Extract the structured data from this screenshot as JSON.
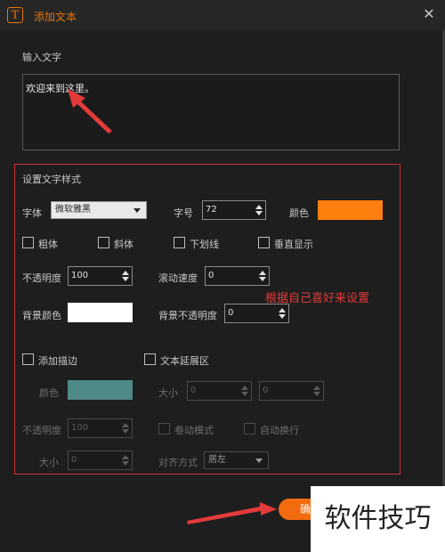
{
  "dialog": {
    "icon_glyph": "T",
    "title": "添加文本",
    "close_glyph": "✕"
  },
  "input_section": {
    "label": "输入文字",
    "value": "欢迎来到这里。"
  },
  "style_section": {
    "title": "设置文字样式",
    "font_label": "字体",
    "font_value": "微软雅黑",
    "size_label": "字号",
    "size_value": "72",
    "color_label": "颜色",
    "text_color": "#ff7f0e",
    "bold_label": "粗体",
    "italic_label": "斜体",
    "underline_label": "下划线",
    "vertical_label": "垂直显示",
    "opacity_label": "不透明度",
    "opacity_value": "100",
    "scroll_speed_label": "滚动速度",
    "scroll_speed_value": "0",
    "bg_color_label": "背景颜色",
    "bg_color": "#ffffff",
    "bg_opacity_label": "背景不透明度",
    "bg_opacity_value": "0"
  },
  "annotation": "根据自己喜好来设置",
  "stroke_section": {
    "add_stroke_label": "添加描边",
    "color_label": "颜色",
    "stroke_color": "#4f8a87",
    "opacity_label": "不透明度",
    "opacity_value": "100",
    "size_label": "大小",
    "size_value": "0"
  },
  "expand_section": {
    "expand_label": "文本延展区",
    "size_label": "大小",
    "width_value": "0",
    "height_value": "0",
    "scroll_mode_label": "卷动模式",
    "auto_wrap_label": "自动换行",
    "align_label": "对齐方式",
    "align_value": "居左"
  },
  "confirm_label": "确",
  "watermark": "软件技巧",
  "colors": {
    "accent": "#f26b0f",
    "highlight_border": "#c8323a",
    "arrow": "#e33a3a"
  }
}
